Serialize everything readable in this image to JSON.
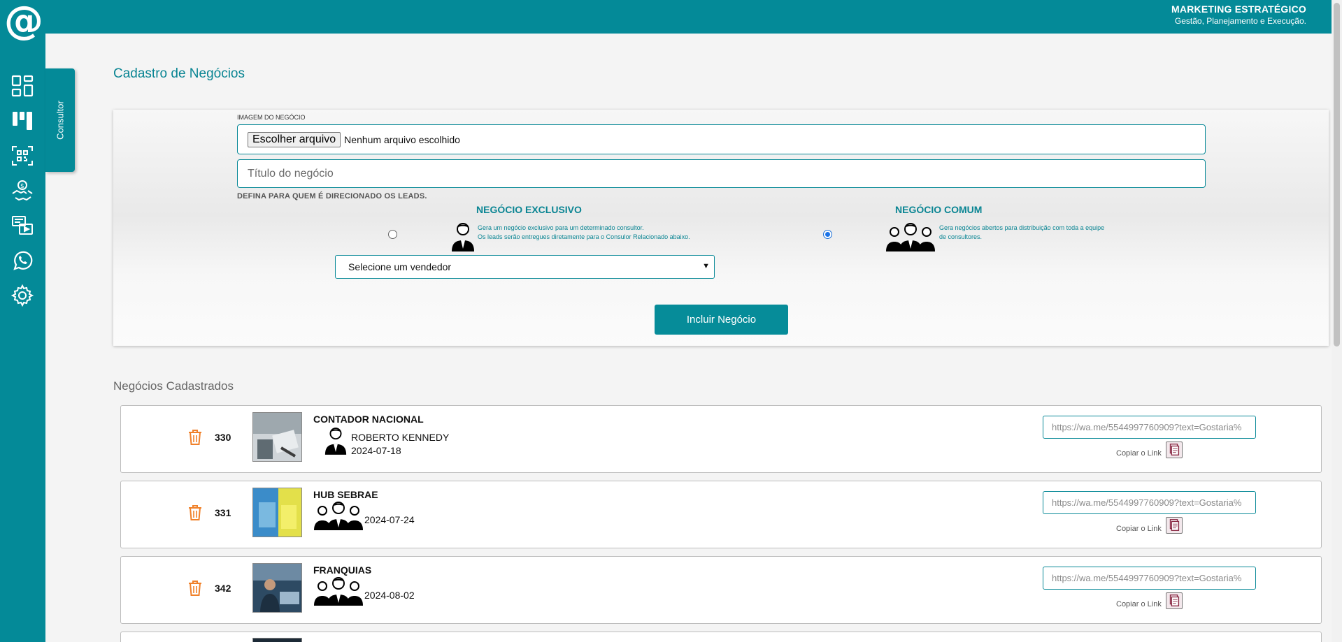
{
  "header": {
    "brand_title": "MARKETING ESTRATÉGICO",
    "brand_subtitle": "Gestão, Planejamento e Execução."
  },
  "sidebar": {
    "logo": "@",
    "icons": [
      "dashboard-icon",
      "kanban-icon",
      "qr-scan-icon",
      "money-handshake-icon",
      "media-icon",
      "whatsapp-icon",
      "gear-icon"
    ],
    "tab_label": "Consultor"
  },
  "page": {
    "title": "Cadastro de Negócios"
  },
  "form": {
    "image_label": "IMAGEM DO NEGÓCIO",
    "file_button": "Escolher arquivo",
    "file_status": "Nenhum arquivo escolhido",
    "title_placeholder": "Título do negócio",
    "define_label": "DEFINA PARA QUEM É DIRECIONADO OS LEADS.",
    "exclusive": {
      "title": "NEGÓCIO EXCLUSIVO",
      "desc_line1": "Gera um negócio exclusivo para um determinado consultor.",
      "desc_line2": "Os leads serão entregues diretamente para o Consulor Relacionado abaixo.",
      "selected": false
    },
    "common": {
      "title": "NEGÓCIO COMUM",
      "desc_line1": "Gera negócios abertos para distribuição com toda a equipe",
      "desc_line2": "de consultores.",
      "selected": true
    },
    "vendor_select": "Selecione um vendedor",
    "submit_label": "Incluir Negócio"
  },
  "list": {
    "title": "Negócios Cadastrados",
    "copy_label": "Copiar o Link",
    "items": [
      {
        "id": "330",
        "name": "CONTADOR NACIONAL",
        "owner": "ROBERTO KENNEDY",
        "date": "2024-07-18",
        "type": "exclusive",
        "link": "https://wa.me/5544997760909?text=Gostaria%"
      },
      {
        "id": "331",
        "name": "HUB SEBRAE",
        "owner": "",
        "date": "2024-07-24",
        "type": "common",
        "link": "https://wa.me/5544997760909?text=Gostaria%"
      },
      {
        "id": "342",
        "name": "FRANQUIAS",
        "owner": "",
        "date": "2024-08-02",
        "type": "common",
        "link": "https://wa.me/5544997760909?text=Gostaria%"
      }
    ]
  },
  "colors": {
    "primary": "#048a98",
    "trash": "#f0812a"
  }
}
